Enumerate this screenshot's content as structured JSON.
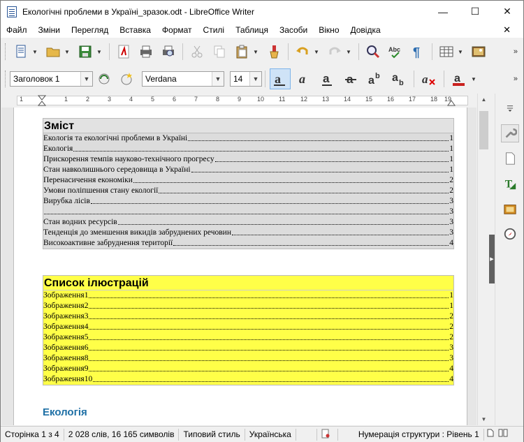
{
  "window": {
    "title": "Екологічні проблеми в Україні_зразок.odt - LibreOffice Writer",
    "minimize": "—",
    "maximize": "☐",
    "close": "✕"
  },
  "menu": {
    "items": [
      "Файл",
      "Зміни",
      "Перегляд",
      "Вставка",
      "Формат",
      "Стилі",
      "Таблиця",
      "Засоби",
      "Вікно",
      "Довідка"
    ],
    "close_document": "✕"
  },
  "toolbar2": {
    "paragraph_style": "Заголовок 1",
    "font_name": "Verdana",
    "font_size": "14"
  },
  "ruler": {
    "numbers": [
      "1",
      "1",
      "2",
      "3",
      "4",
      "5",
      "6",
      "7",
      "8",
      "9",
      "10",
      "11",
      "12",
      "13",
      "14",
      "15",
      "16",
      "17",
      "18",
      "19"
    ]
  },
  "document": {
    "toc": {
      "title": "Зміст",
      "entries": [
        {
          "text": "Екологія та екологічні проблеми в Україні",
          "page": "1"
        },
        {
          "text": "Екологія",
          "page": "1"
        },
        {
          "text": "Прискорення темпів науково-технічного прогресу",
          "page": "1"
        },
        {
          "text": "Стан навколишнього середовища в Україні",
          "page": "1"
        },
        {
          "text": "Перенасичення економіки",
          "page": "2"
        },
        {
          "text": "Умови поліпшення стану екології",
          "page": "2"
        },
        {
          "text": "Вирубка лісів",
          "page": "3"
        },
        {
          "text": "",
          "page": "3"
        },
        {
          "text": " Стан водних ресурсів",
          "page": "3"
        },
        {
          "text": "Тенденція до зменшення викидів забруднених речовин",
          "page": "3"
        },
        {
          "text": "Високоактивне забруднення території",
          "page": "4"
        }
      ]
    },
    "illustrations": {
      "title": "Список ілюстрацій",
      "entries": [
        {
          "text": "Зображення1",
          "page": "1"
        },
        {
          "text": "Зображення2",
          "page": "1"
        },
        {
          "text": "Зображення3",
          "page": "2"
        },
        {
          "text": "Зображення4",
          "page": "2"
        },
        {
          "text": "Зображення5",
          "page": "2"
        },
        {
          "text": "Зображення6",
          "page": "3"
        },
        {
          "text": "Зображення8",
          "page": "3"
        },
        {
          "text": "Зображення9",
          "page": "4"
        },
        {
          "text": "Зображення10",
          "page": "4"
        }
      ]
    },
    "next_heading": "Екологія"
  },
  "status": {
    "page": "Сторінка 1 з 4",
    "words": "2 028 слів, 16 165 символів",
    "page_style": "Типовий стиль",
    "language": "Українська",
    "outline": "Нумерація структури : Рівень 1"
  },
  "colors": {
    "illustration_bg": "#ffff48",
    "toc_bg": "#dcdcdc",
    "heading_blue": "#1d6fa5"
  }
}
